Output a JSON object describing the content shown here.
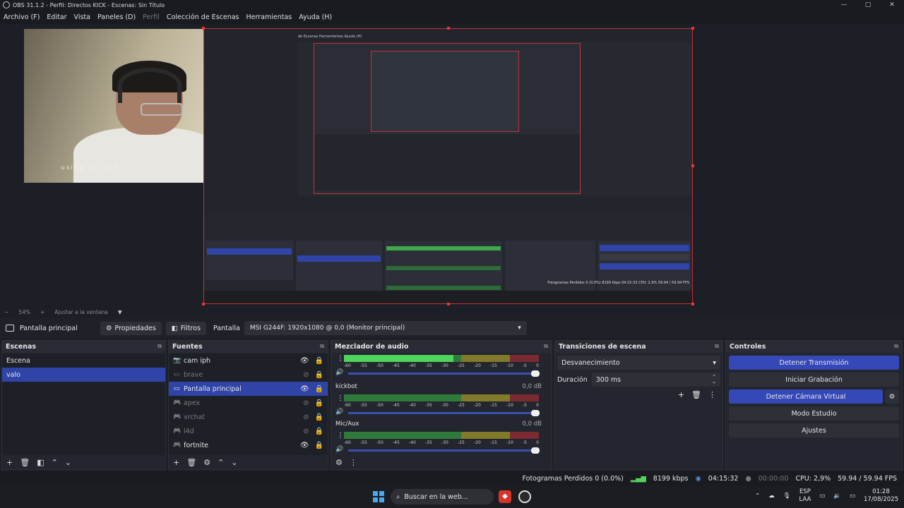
{
  "window": {
    "title": "OBS 31.1.2 - Perfil: Directos KICK - Escenas: Sin Título",
    "controls": [
      "—",
      "▢",
      "✕"
    ]
  },
  "menu": {
    "items": [
      "Archivo (F)",
      "Editar",
      "Vista",
      "Paneles (D)",
      "Perfil",
      "Colección de Escenas",
      "Herramientas",
      "Ayuda (H)"
    ]
  },
  "preview": {
    "cam_overlay_text": "using   ui   tora",
    "inner_menu": "de Escenas   Herramientas   Ayuda (H)",
    "mini_status": "Fotogramas Perdidos 0 (0.0%)   8199 kbps   04:15:32   CPU: 2,9%   59.94 / 59.94 FPS"
  },
  "zoom": {
    "minus": "−",
    "percent": "54%",
    "plus": "+",
    "fit_label": "Ajustar a la ventana"
  },
  "source_bar": {
    "current_source": "Pantalla principal",
    "properties_label": "Propiedades",
    "filters_label": "Filtros",
    "display_label": "Pantalla",
    "display_value": "MSI G244F: 1920x1080 @ 0,0 (Monitor principal)"
  },
  "scenes": {
    "title": "Escenas",
    "items": [
      {
        "label": "Escena",
        "selected": false
      },
      {
        "label": "valo",
        "selected": true
      }
    ]
  },
  "sources": {
    "title": "Fuentes",
    "items": [
      {
        "label": "cam iph",
        "icon": "camera-icon",
        "visible": true,
        "selected": false
      },
      {
        "label": "brave",
        "icon": "window-icon",
        "visible": false,
        "selected": false
      },
      {
        "label": "Pantalla principal",
        "icon": "monitor-icon",
        "visible": true,
        "selected": true
      },
      {
        "label": "apex",
        "icon": "gamepad-icon",
        "visible": false,
        "selected": false
      },
      {
        "label": "vrchat",
        "icon": "gamepad-icon",
        "visible": false,
        "selected": false
      },
      {
        "label": "l4d",
        "icon": "gamepad-icon",
        "visible": false,
        "selected": false
      },
      {
        "label": "fortnite",
        "icon": "gamepad-icon",
        "visible": true,
        "selected": false
      }
    ]
  },
  "mixer": {
    "title": "Mezclador de audio",
    "ticks": [
      "-60",
      "-55",
      "-50",
      "-45",
      "-40",
      "-35",
      "-30",
      "-25",
      "-20",
      "-15",
      "-10",
      "-5",
      "0"
    ],
    "channels": [
      {
        "name": "",
        "db": "",
        "level": 0.7
      },
      {
        "name": "kickbot",
        "db": "0,0 dB",
        "level": 0.0
      },
      {
        "name": "Mic/Aux",
        "db": "0,0 dB",
        "level": 0.0
      }
    ]
  },
  "transitions": {
    "title": "Transiciones de escena",
    "type": "Desvanecimiento",
    "duration_label": "Duración",
    "duration_value": "300 ms"
  },
  "controls": {
    "title": "Controles",
    "stop_stream": "Detener Transmisión",
    "start_recording": "Iniciar Grabación",
    "stop_virtual_cam": "Detener Cámara Virtual",
    "studio_mode": "Modo Estudio",
    "settings": "Ajustes"
  },
  "status": {
    "dropped_frames": "Fotogramas Perdidos 0 (0.0%)",
    "bitrate": "8199 kbps",
    "stream_time": "04:15:32",
    "record_time": "00:00:00",
    "cpu": "CPU: 2,9%",
    "fps": "59.94 / 59.94 FPS"
  },
  "taskbar": {
    "search_placeholder": "Buscar en la web...",
    "lang_top": "ESP",
    "lang_bottom": "LAA",
    "time": "01:28",
    "date": "17/08/2025"
  },
  "colors": {
    "accent": "#3548b8",
    "selection": "#3044a8",
    "recording_border": "#c8303a"
  }
}
